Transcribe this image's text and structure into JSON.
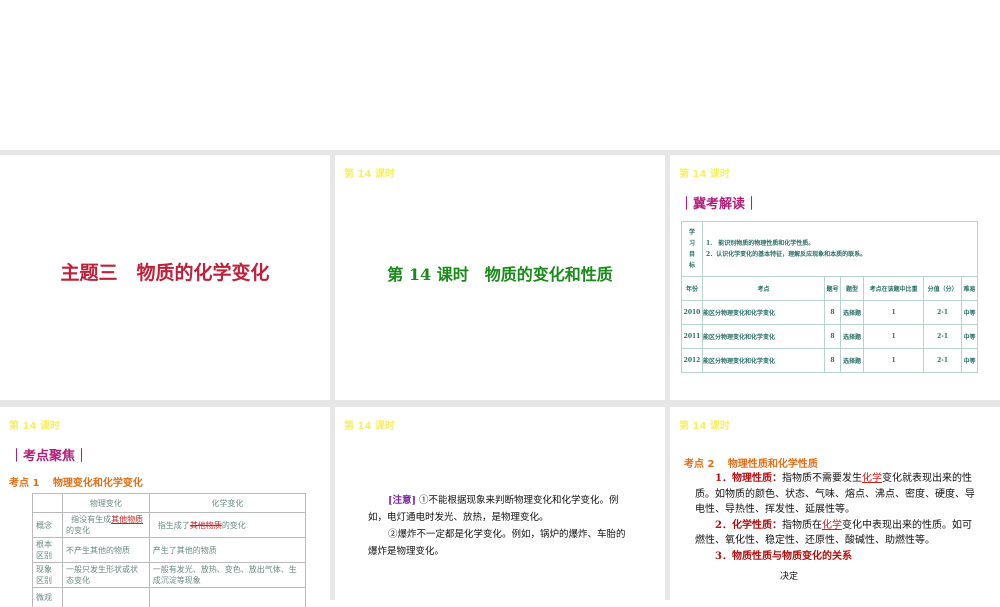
{
  "header": "第 14 课时",
  "slide1": {
    "title": "主题三　物质的化学变化"
  },
  "slide2": {
    "title": "第 14 课时　物质的变化和性质"
  },
  "slide3": {
    "section": "｜冀考解读｜",
    "goal_label": [
      "学",
      "习",
      "目",
      "标"
    ],
    "goals": [
      "1.　能识别物质的物理性质和化学性质。",
      "2．认识化学变化的基本特征，理解反应现象和本质的联系。"
    ],
    "columns": [
      "年份",
      "考点",
      "题号",
      "题型",
      "考点在该题中比重",
      "分值（分）",
      "难易"
    ],
    "rows": [
      [
        "2010",
        "能区分物理变化和化学变化",
        "8",
        "选择题",
        "1",
        "2-1",
        "中等"
      ],
      [
        "2011",
        "能区分物理变化和化学变化",
        "8",
        "选择题",
        "1",
        "2-1",
        "中等"
      ],
      [
        "2012",
        "能区分物理变化和化学变化",
        "8",
        "选择题",
        "1",
        "2-1",
        "中等"
      ]
    ]
  },
  "slide4": {
    "section": "｜考点聚焦｜",
    "kaodian": "考点 1　 物理变化和化学变化",
    "columns": [
      "",
      "物理变化",
      "化学变化"
    ],
    "rows": [
      {
        "label": "概念",
        "a_pre": "指没有生成",
        "a_fill": "其他物质",
        "a_post": "的变化",
        "b_pre": "指生成了",
        "b_fill": "其他物质",
        "b_post": "的变化"
      },
      {
        "label": "根本区别",
        "a": "不产生其他的物质",
        "b": "产生了其他的物质"
      },
      {
        "label": "现象区别",
        "a": "一般只发生形状或状态变化",
        "b": "一般有发光、放热、变色、放出气体、生成沉淀等现象"
      },
      {
        "label": "微观",
        "a": "",
        "b": ""
      }
    ]
  },
  "slide5": {
    "note_label": "[注意]",
    "p1": "①不能根据现象来判断物理变化和化学变化。例如，电灯通电时发光、放热，是物理变化。",
    "p2": "②爆炸不一定都是化学变化。例如，锅炉的爆炸、车胎的爆炸是物理变化。"
  },
  "slide6": {
    "kaodian": "考点 2　 物理性质和化学性质",
    "p1_label": "1．物理性质：",
    "p1_pre": "指物质不需要发生",
    "p1_fill": "化学",
    "p1_post": "变化就表现出来的性质。如物质的颜色、状态、气味、熔点、沸点、密度、硬度、导电性、导热性、挥发性、延展性等。",
    "p2_label": "2．化学性质：",
    "p2_pre": "指物质在",
    "p2_fill": "化学",
    "p2_post": "变化中表现出来的性质。如可燃性、氧化性、稳定性、还原性、酸碱性、助燃性等。",
    "p3": "3．物质性质与物质变化的关系",
    "p4": "决定"
  }
}
